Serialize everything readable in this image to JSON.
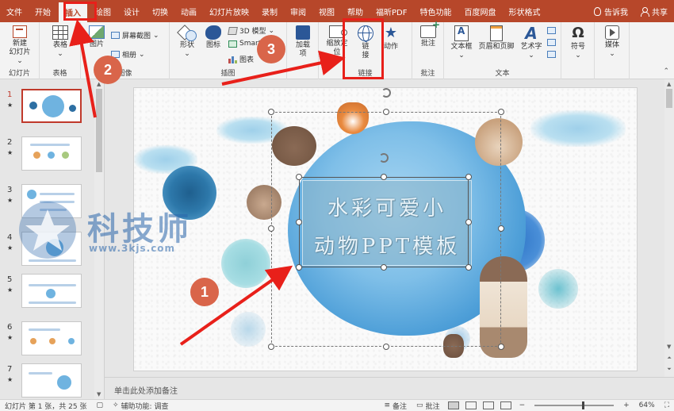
{
  "tabs": [
    {
      "label": "文件"
    },
    {
      "label": "开始"
    },
    {
      "label": "插入",
      "active": true
    },
    {
      "label": "绘图"
    },
    {
      "label": "设计"
    },
    {
      "label": "切换"
    },
    {
      "label": "动画"
    },
    {
      "label": "幻灯片放映"
    },
    {
      "label": "录制"
    },
    {
      "label": "审阅"
    },
    {
      "label": "视图"
    },
    {
      "label": "帮助"
    },
    {
      "label": "福昕PDF"
    },
    {
      "label": "特色功能"
    },
    {
      "label": "百度网盘"
    },
    {
      "label": "形状格式"
    }
  ],
  "tell_me": "告诉我",
  "share": "共享",
  "ribbon": {
    "new_slide_line1": "新建",
    "new_slide_line2": "幻灯片",
    "grp_slides": "幻灯片",
    "table": "表格",
    "grp_tables": "表格",
    "picture": "图片",
    "screenshot": "屏幕截图",
    "album": "相册",
    "grp_images": "图像",
    "shapes": "形状",
    "icons": "图标",
    "model3d": "3D 模型",
    "smartart": "SmartArt",
    "chart": "图表",
    "grp_illustrations": "插图",
    "addins_line1": "加载",
    "addins_line2": "项",
    "zoom_line1": "缩放定",
    "zoom_line2": "位",
    "link_line1": "链",
    "link_line2": "接",
    "action": "动作",
    "grp_links": "链接",
    "comment": "批注",
    "grp_comments": "批注",
    "textbox": "文本框",
    "header_footer": "页眉和页脚",
    "wordart": "艺术字",
    "grp_text": "文本",
    "symbol": "符号",
    "media": "媒体"
  },
  "thumbnails": [
    {
      "num": "1",
      "star": "★",
      "selected": true
    },
    {
      "num": "2",
      "star": "★"
    },
    {
      "num": "3",
      "star": "★"
    },
    {
      "num": "4",
      "star": "★"
    },
    {
      "num": "5",
      "star": "★"
    },
    {
      "num": "6",
      "star": "★"
    },
    {
      "num": "7",
      "star": "★"
    }
  ],
  "slide": {
    "title_line1": "水彩可爱小",
    "title_line2": "动物PPT模板"
  },
  "notes_placeholder": "单击此处添加备注",
  "status": {
    "slide_info": "幻灯片 第 1 张，共 25 张",
    "accessibility": "辅助功能: 调查",
    "notes": "备注",
    "comments": "批注",
    "zoom": "64%"
  },
  "annotations": {
    "n1": "1",
    "n2": "2",
    "n3": "3"
  },
  "watermark": {
    "text": "科技师",
    "url": "www.3kjs.com"
  }
}
